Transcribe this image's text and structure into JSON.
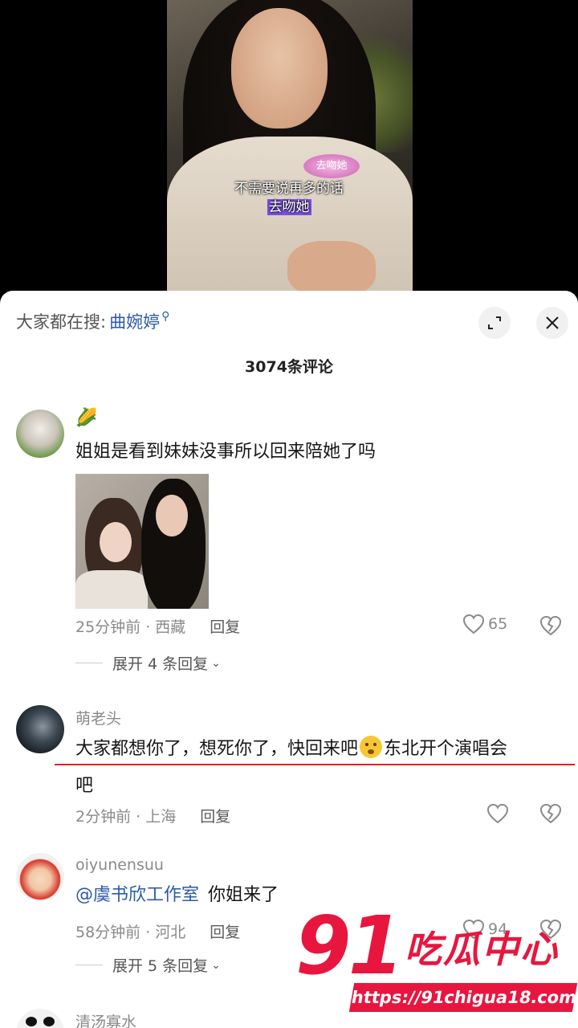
{
  "video": {
    "sticker_text": "去吻她",
    "caption_line1": "不需要说再多的话",
    "caption_line2": "去吻她"
  },
  "search": {
    "prefix": "大家都在搜:",
    "term": "曲婉婷",
    "icon": "search-icon"
  },
  "header": {
    "comment_count": "3074条评论",
    "expand_icon": "expand-icon",
    "close_icon": "close-icon"
  },
  "comments": [
    {
      "author": "🌽",
      "text": "姐姐是看到妹妹没事所以回来陪她了吗",
      "time_location": "25分钟前 · 西藏",
      "reply": "回复",
      "likes": "65",
      "expand": "展开 4 条回复"
    },
    {
      "author": "萌老头",
      "text_line1_a": "大家都想你了，想死你了，快回来吧",
      "text_line1_b": "东北开个演唱会",
      "text_line2": "吧",
      "time_location": "2分钟前 · 上海",
      "reply": "回复"
    },
    {
      "author": "oiyunensuu",
      "mention": "@虞书欣工作室",
      "text": "你姐来了",
      "time_location": "58分钟前 · 河北",
      "reply": "回复",
      "likes": "94",
      "expand": "展开 5 条回复"
    },
    {
      "author": "清汤寡水"
    }
  ],
  "watermark": {
    "number": "91",
    "name": "吃瓜中心",
    "url": "https://91chigua18.com"
  },
  "colors": {
    "accent_blue": "#2b5aa8",
    "highlight_red": "#e0202b",
    "watermark_red": "#e8163f"
  }
}
